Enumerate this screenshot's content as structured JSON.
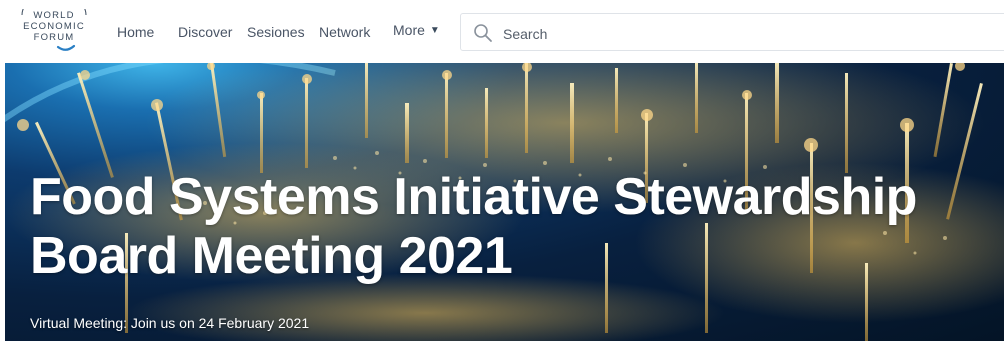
{
  "header": {
    "logo": {
      "line1": "WORLD",
      "line2": "ECONOMIC",
      "line3": "FORUM"
    },
    "nav": [
      {
        "label": "Home"
      },
      {
        "label": "Discover"
      },
      {
        "label": "Sesiones"
      },
      {
        "label": "Network"
      }
    ],
    "more_label": "More",
    "search": {
      "placeholder": "Search",
      "icon": "search-icon"
    }
  },
  "hero": {
    "title_line1": "Food Systems Initiative Stewardship",
    "title_line2": "Board Meeting 2021",
    "subtitle": "Virtual Meeting: Join us on 24 February 2021"
  },
  "colors": {
    "nav_text": "#4a5566",
    "search_border": "#dfe3e8",
    "hero_deep": "#08203f",
    "hero_glow": "#3fb4e8",
    "city_lights": "#f5c65a"
  }
}
